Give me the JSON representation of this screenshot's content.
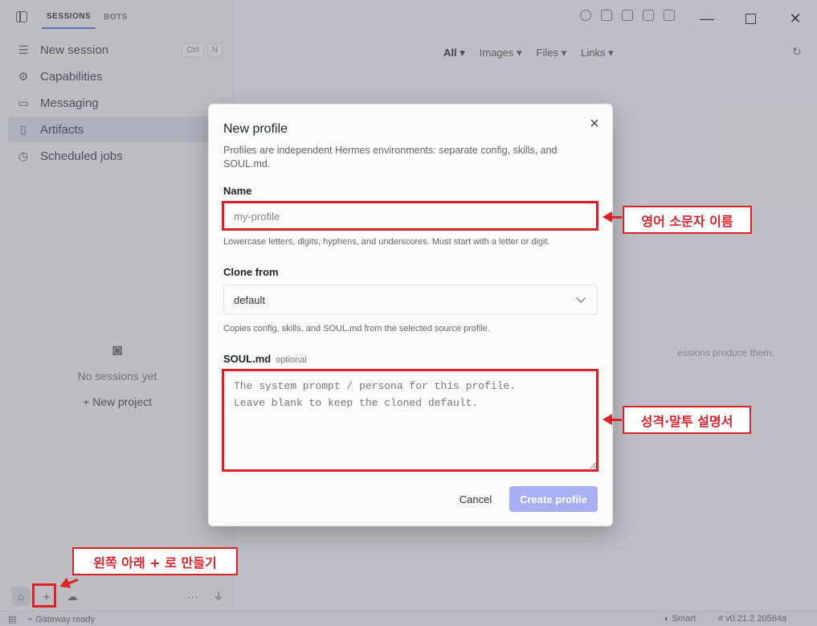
{
  "sidebar": {
    "tabs": [
      "SESSIONS",
      "BOTS"
    ],
    "items": [
      {
        "label": "New session",
        "icon": "new-session-icon",
        "kbd": [
          "Ctrl",
          "N"
        ]
      },
      {
        "label": "Capabilities",
        "icon": "capabilities-icon"
      },
      {
        "label": "Messaging",
        "icon": "messaging-icon"
      },
      {
        "label": "Artifacts",
        "icon": "artifacts-icon",
        "active": true
      },
      {
        "label": "Scheduled jobs",
        "icon": "scheduled-jobs-icon"
      }
    ],
    "empty_text": "No sessions yet",
    "new_project": "New project",
    "more": "···"
  },
  "main": {
    "filters": [
      "All ▾",
      "Images ▾",
      "Files ▾",
      "Links ▾"
    ],
    "bg_hint": "essions produce them."
  },
  "status": {
    "gateway": "Gateway ready",
    "mode": "Smart",
    "version": "v0.21.2 20584a"
  },
  "modal": {
    "title": "New profile",
    "close": "×",
    "description": "Profiles are independent Hermes environments: separate config, skills, and SOUL.md.",
    "name_label": "Name",
    "name_placeholder": "my-profile",
    "name_hint": "Lowercase letters, digits, hyphens, and underscores. Must start with a letter or digit.",
    "clone_label": "Clone from",
    "clone_value": "default",
    "clone_hint": "Copies config, skills, and SOUL.md from the selected source profile.",
    "soul_label": "SOUL.md",
    "soul_optional": "optional",
    "soul_placeholder": "The system prompt / persona for this profile.\nLeave blank to keep the cloned default.",
    "cancel": "Cancel",
    "create": "Create profile"
  },
  "annotations": {
    "name_note": "영어 소문자 이름",
    "soul_note": "성격·말투 설명서",
    "plus_note": "왼쪽 아래 + 로 만들기"
  },
  "colors": {
    "accent": "#5b6ee8",
    "create_button": "#a7aff2",
    "annotation_red": "#d9222a"
  }
}
